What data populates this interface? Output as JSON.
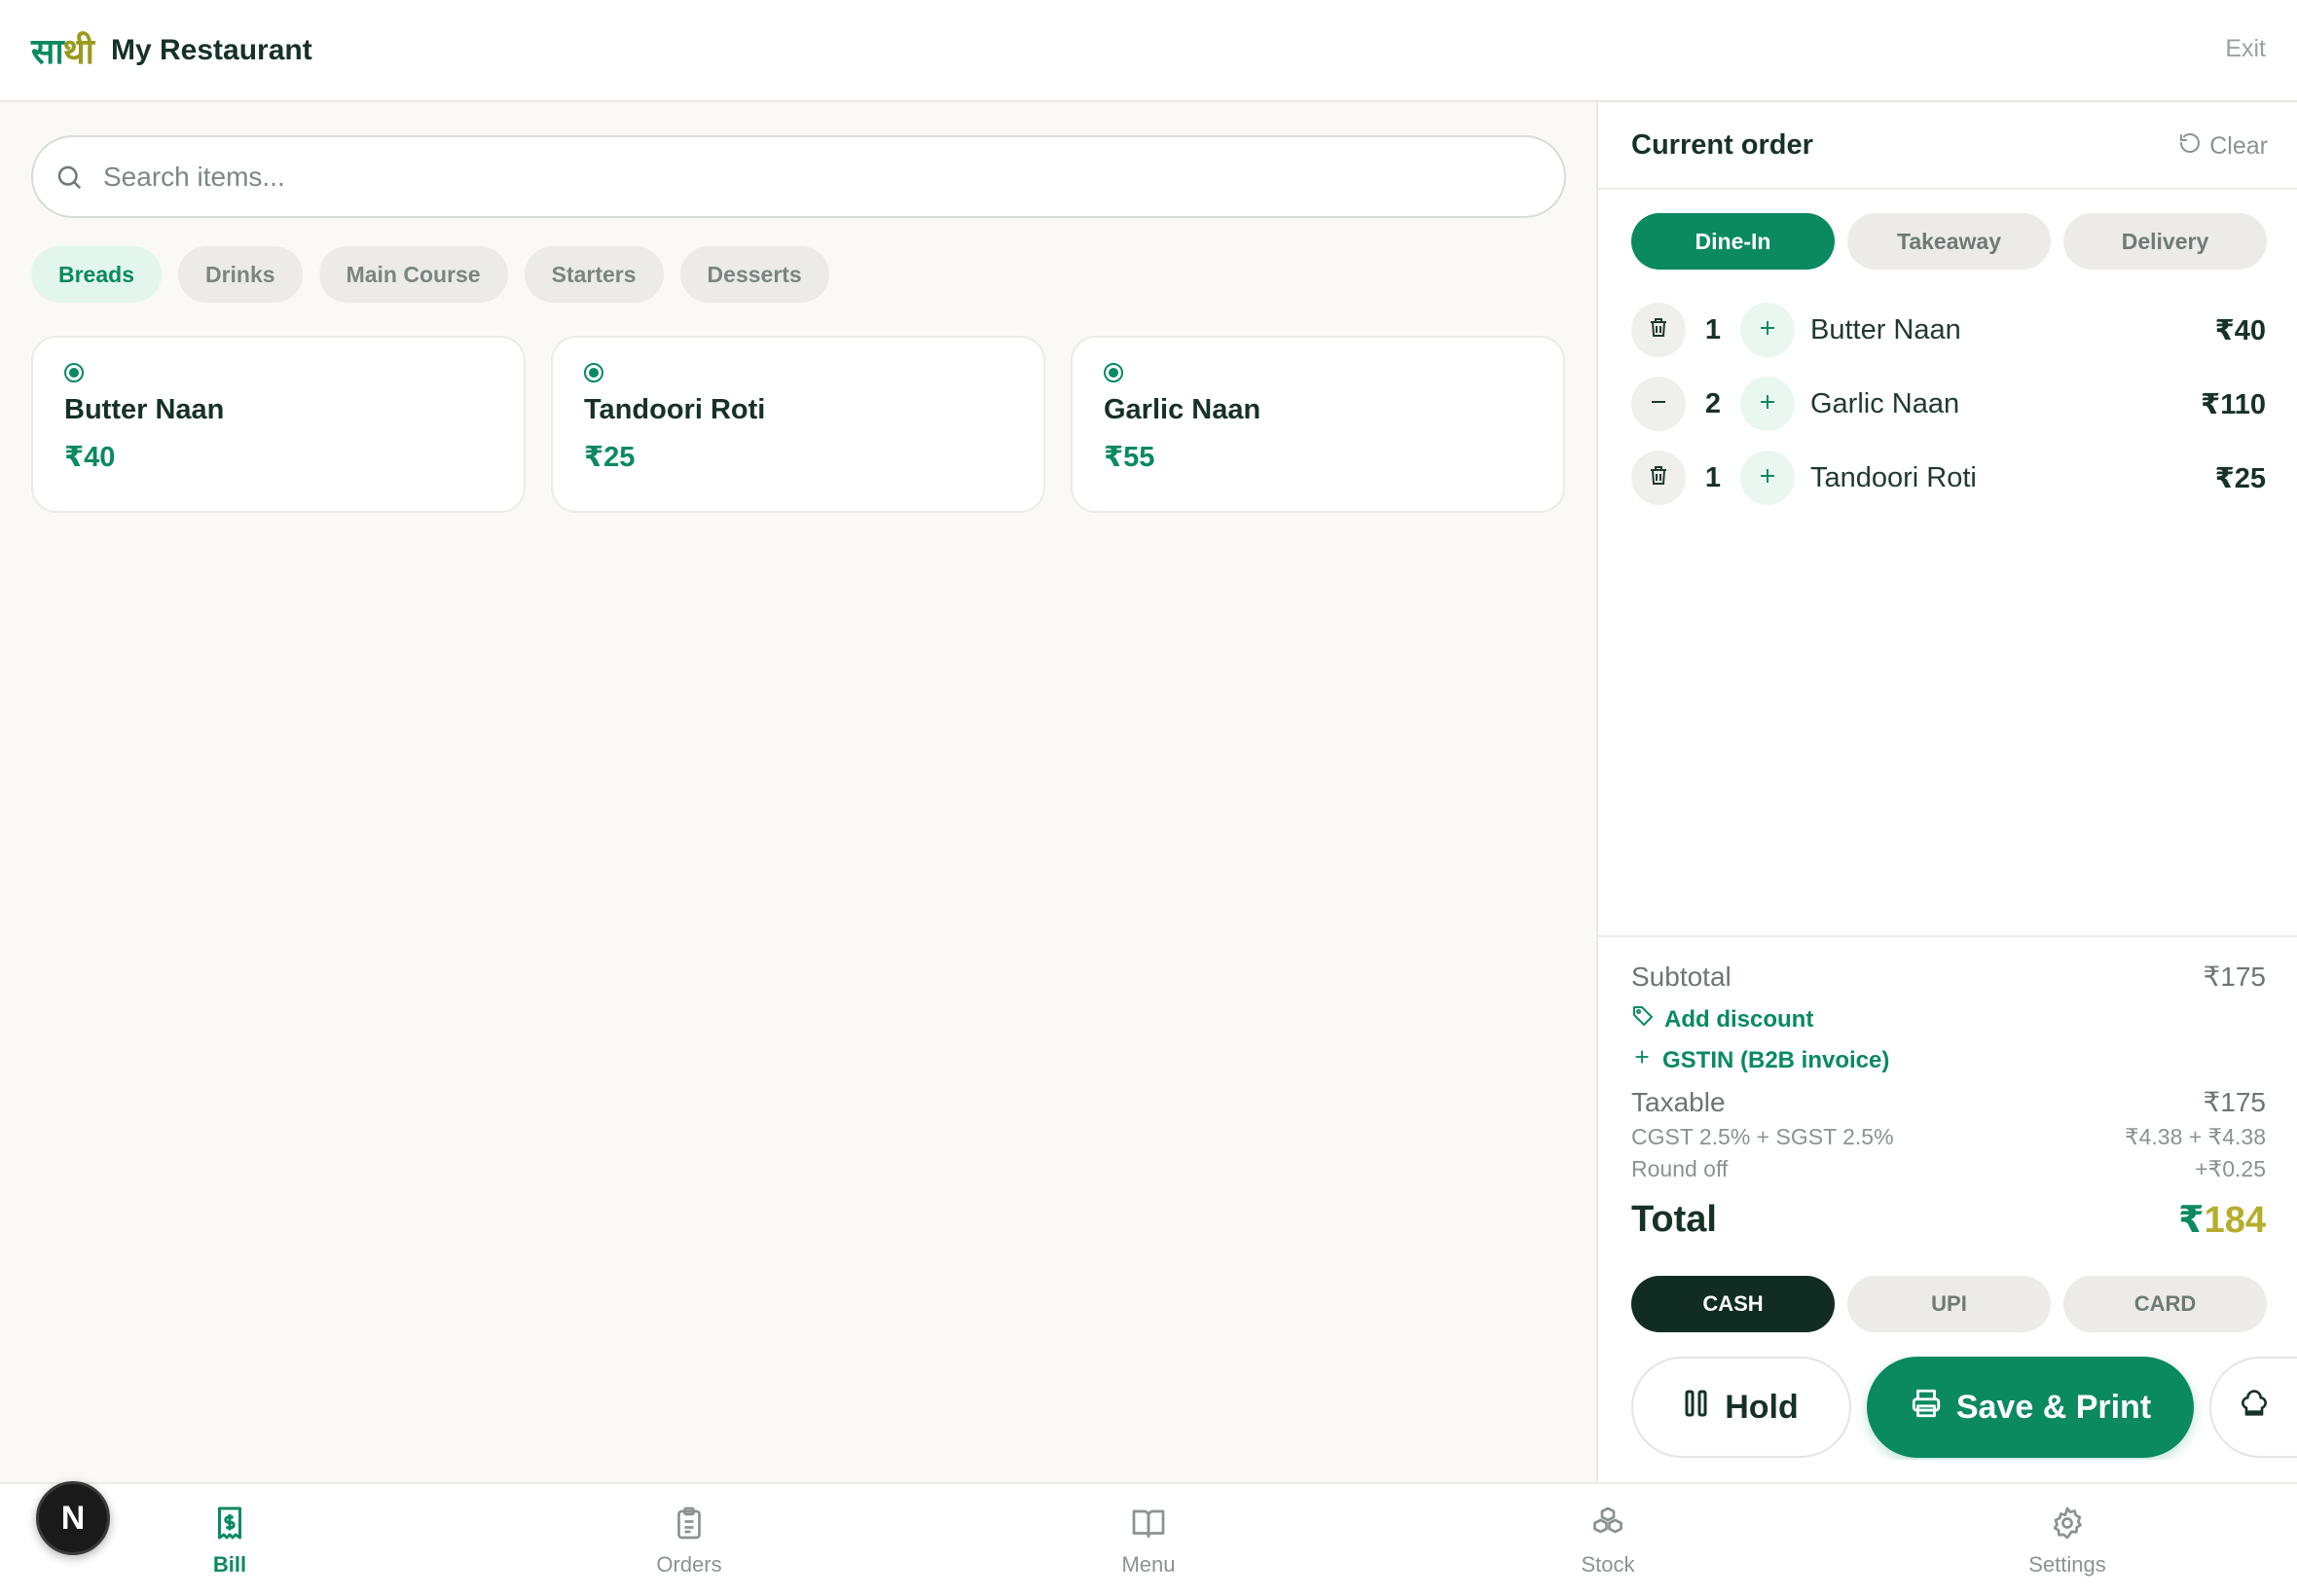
{
  "header": {
    "logo_part1": "सा",
    "logo_part2": "थी",
    "title": "My Restaurant",
    "exit_label": "Exit"
  },
  "search": {
    "placeholder": "Search items..."
  },
  "categories": [
    {
      "label": "Breads",
      "active": true
    },
    {
      "label": "Drinks",
      "active": false
    },
    {
      "label": "Main Course",
      "active": false
    },
    {
      "label": "Starters",
      "active": false
    },
    {
      "label": "Desserts",
      "active": false
    }
  ],
  "items": [
    {
      "name": "Butter Naan",
      "price": "₹40"
    },
    {
      "name": "Tandoori Roti",
      "price": "₹25"
    },
    {
      "name": "Garlic Naan",
      "price": "₹55"
    }
  ],
  "order": {
    "title": "Current order",
    "clear_label": "Clear",
    "types": [
      {
        "label": "Dine-In",
        "active": true
      },
      {
        "label": "Takeaway",
        "active": false
      },
      {
        "label": "Delivery",
        "active": false
      }
    ],
    "lines": [
      {
        "qty": "1",
        "name": "Butter Naan",
        "price": "₹40",
        "minus_icon": "trash-icon"
      },
      {
        "qty": "2",
        "name": "Garlic Naan",
        "price": "₹110",
        "minus_icon": "minus-icon"
      },
      {
        "qty": "1",
        "name": "Tandoori Roti",
        "price": "₹25",
        "minus_icon": "trash-icon"
      }
    ]
  },
  "summary": {
    "subtotal_label": "Subtotal",
    "subtotal": "₹175",
    "discount_label": "Add discount",
    "gstin_label": "GSTIN (B2B invoice)",
    "taxable_label": "Taxable",
    "taxable": "₹175",
    "tax_label": "CGST 2.5% + SGST 2.5%",
    "tax": "₹4.38 + ₹4.38",
    "roundoff_label": "Round off",
    "roundoff": "+₹0.25",
    "total_label": "Total",
    "total_symbol": "₹",
    "total_value": "184"
  },
  "payment": [
    {
      "label": "CASH",
      "active": true
    },
    {
      "label": "UPI",
      "active": false
    },
    {
      "label": "CARD",
      "active": false
    }
  ],
  "actions": {
    "hold_label": "Hold",
    "save_label": "Save & Print"
  },
  "nav": [
    {
      "label": "Bill",
      "icon": "bill-icon",
      "active": true
    },
    {
      "label": "Orders",
      "icon": "clipboard-icon",
      "active": false
    },
    {
      "label": "Menu",
      "icon": "book-icon",
      "active": false
    },
    {
      "label": "Stock",
      "icon": "boxes-icon",
      "active": false
    },
    {
      "label": "Settings",
      "icon": "gear-icon",
      "active": false
    }
  ],
  "avatar_letter": "N",
  "colors": {
    "brand_green": "#0a8a5e",
    "dark": "#112c23",
    "gold": "#b5ad2c"
  }
}
